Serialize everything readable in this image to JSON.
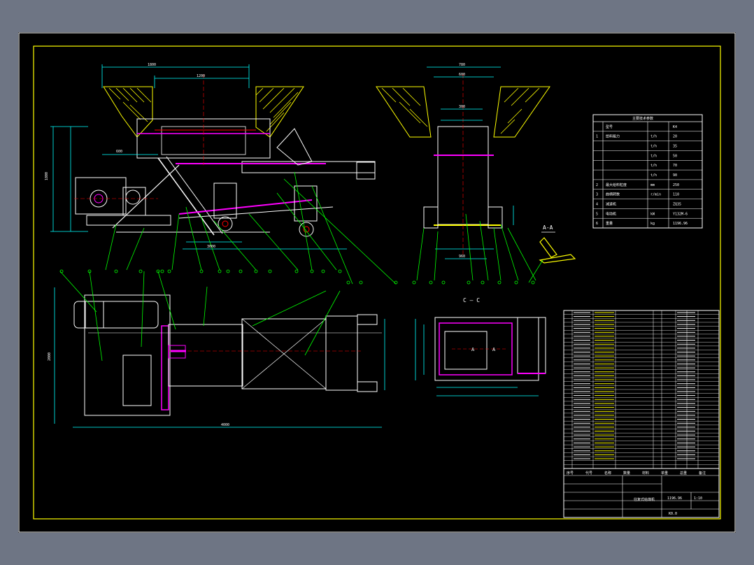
{
  "drawing": {
    "section_label_aa": "A-A",
    "section_label_cc": "C — C",
    "view_mark_a1": "A",
    "view_mark_a2": "A"
  },
  "tech_table": {
    "title": "主要技术参数",
    "rows": [
      {
        "no": "",
        "name": "型号",
        "unit": "",
        "value": "K4"
      },
      {
        "no": "1",
        "name": "给料能力",
        "unit": "t/h",
        "value": "20"
      },
      {
        "no": "",
        "name": "",
        "unit": "t/h",
        "value": "35"
      },
      {
        "no": "",
        "name": "",
        "unit": "t/h",
        "value": "50"
      },
      {
        "no": "",
        "name": "",
        "unit": "t/h",
        "value": "70"
      },
      {
        "no": "",
        "name": "",
        "unit": "t/h",
        "value": "90"
      },
      {
        "no": "2",
        "name": "最大给料粒度",
        "unit": "mm",
        "value": "250"
      },
      {
        "no": "3",
        "name": "曲柄转数",
        "unit": "r/min",
        "value": "110"
      },
      {
        "no": "4",
        "name": "减速机",
        "unit": "",
        "value": "ZQ35"
      },
      {
        "no": "5",
        "name": "电动机",
        "unit": "kW",
        "value": "Y132M-6"
      },
      {
        "no": "6",
        "name": "重量",
        "unit": "kg",
        "value": "1196.96"
      }
    ]
  },
  "title_block": {
    "drawing_name": "往复式给煤机",
    "scale": "1:10",
    "weight": "1196.96",
    "sheet_no": "K0.0",
    "company": "",
    "headers": [
      "序号",
      "代号",
      "名称",
      "数量",
      "材料",
      "单重",
      "总重",
      "备注"
    ]
  }
}
